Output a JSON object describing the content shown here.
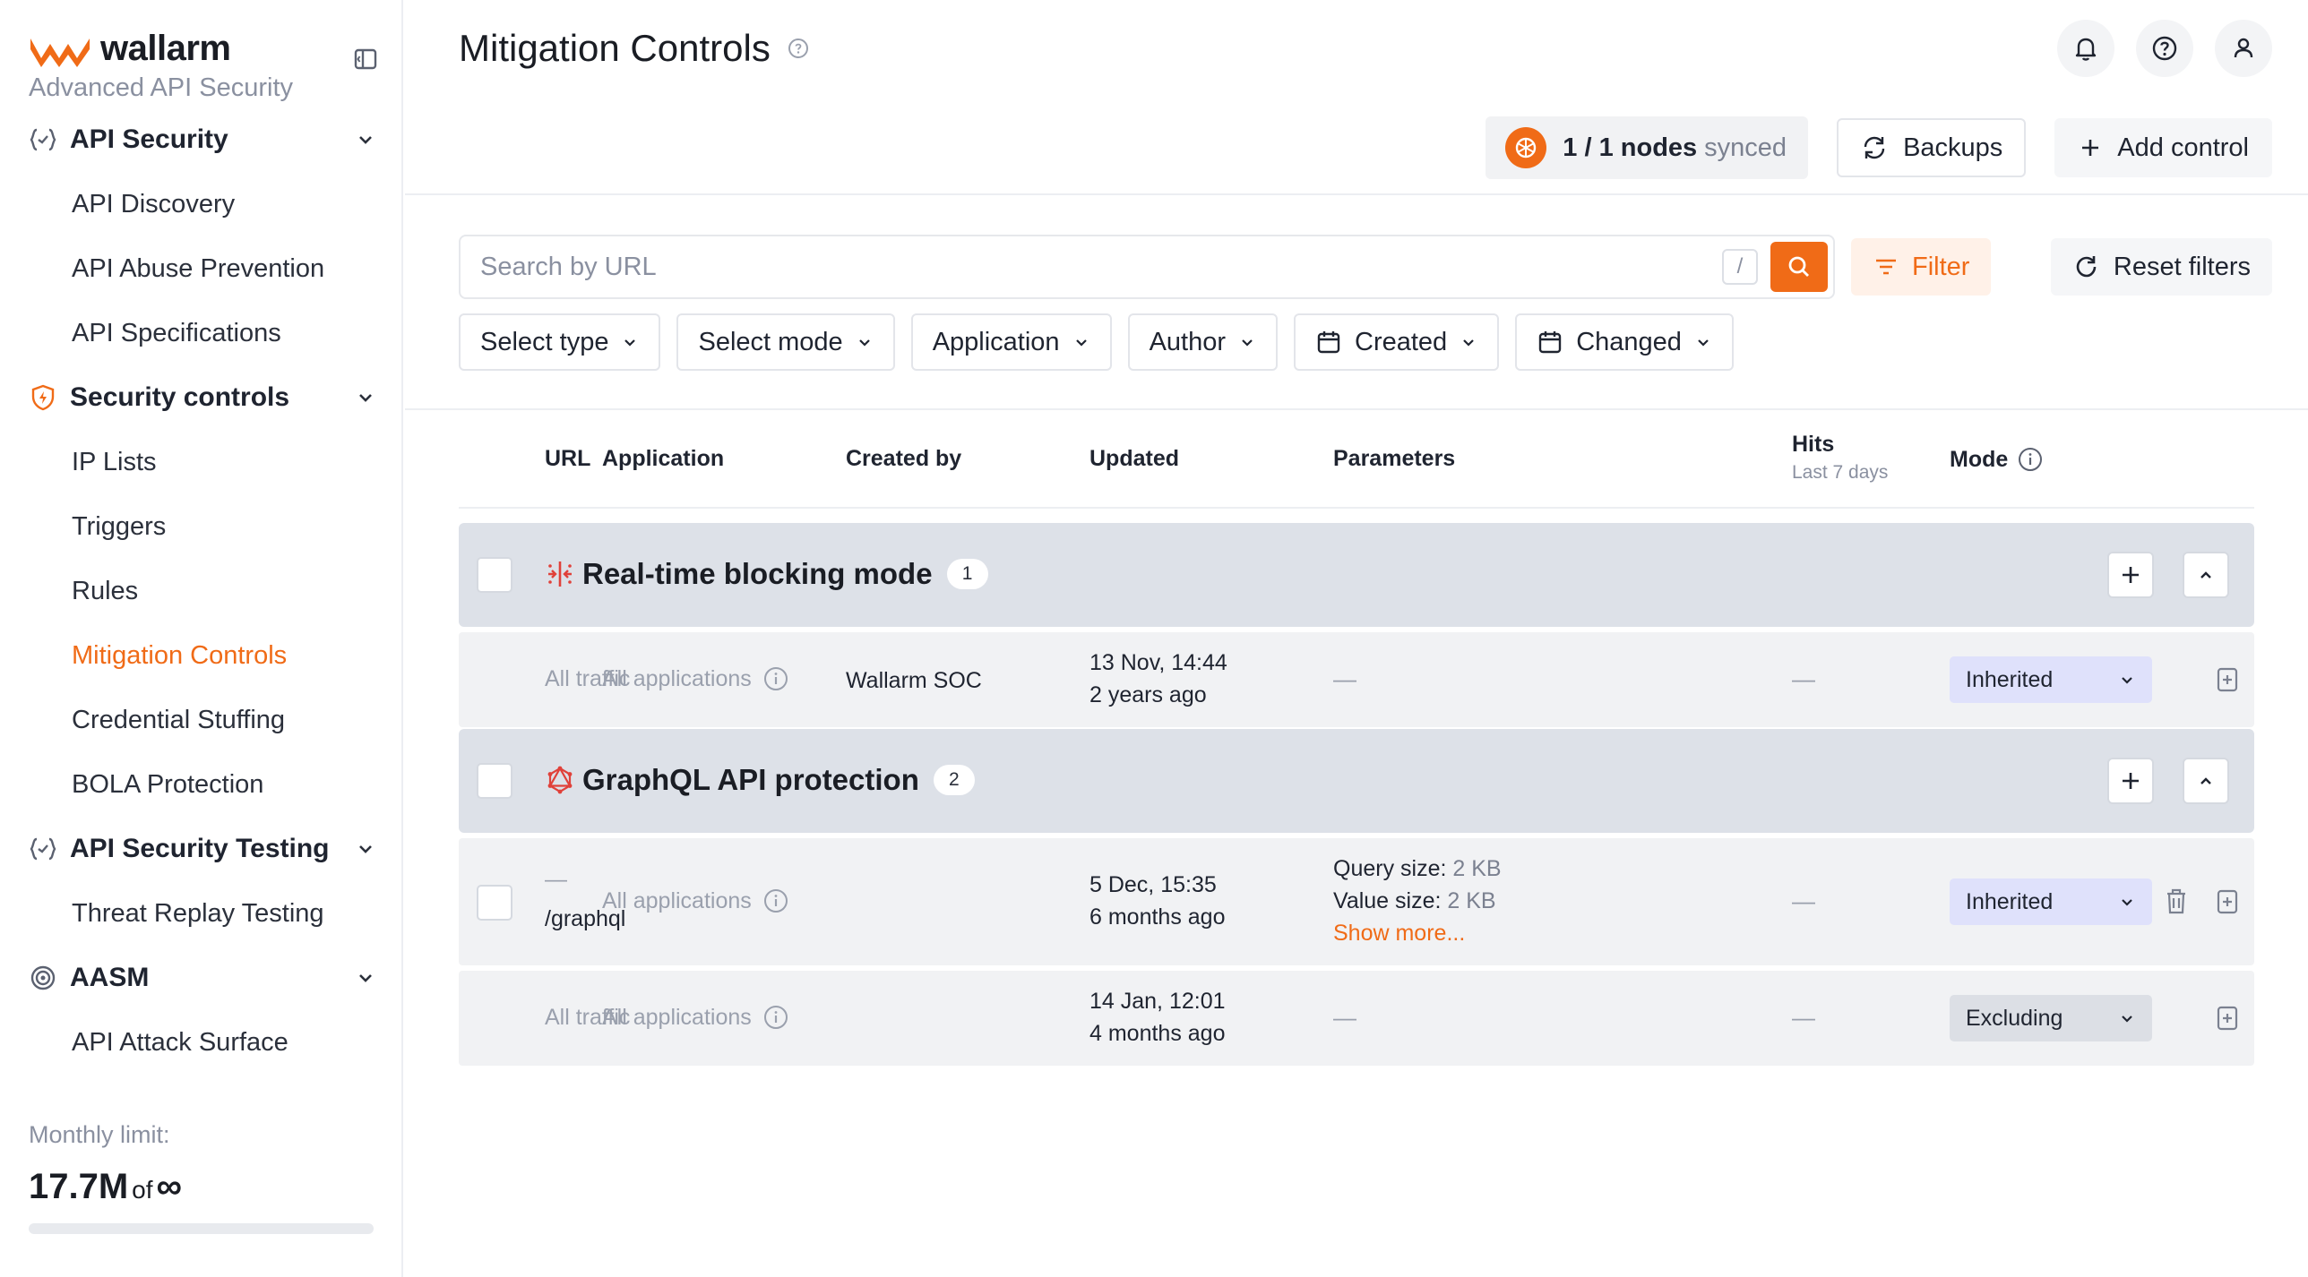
{
  "brand": {
    "name": "wallarm",
    "subtitle": "Advanced API Security",
    "accent": "#f06b17"
  },
  "sidebar": {
    "sections": [
      {
        "label": "API Security",
        "icon": "api-braces-icon",
        "items": [
          "API Discovery",
          "API Abuse Prevention",
          "API Specifications"
        ]
      },
      {
        "label": "Security controls",
        "icon": "shield-icon",
        "items": [
          "IP Lists",
          "Triggers",
          "Rules",
          "Mitigation Controls",
          "Credential Stuffing",
          "BOLA Protection"
        ]
      },
      {
        "label": "API Security Testing",
        "icon": "api-braces-icon",
        "items": [
          "Threat Replay Testing"
        ]
      },
      {
        "label": "AASM",
        "icon": "radar-icon",
        "items": [
          "API Attack Surface"
        ]
      }
    ],
    "active_item": "Mitigation Controls",
    "footer": {
      "limit_label": "Monthly limit:",
      "limit_value": "17.7M",
      "limit_of": "of",
      "limit_total": "∞"
    }
  },
  "header": {
    "title": "Mitigation Controls",
    "sync": {
      "count": "1 / 1 nodes",
      "status": "synced"
    },
    "backups_label": "Backups",
    "add_label": "Add control"
  },
  "search": {
    "placeholder": "Search by URL",
    "shortcut": "/"
  },
  "filter_label": "Filter",
  "reset_label": "Reset filters",
  "dropdowns": [
    "Select type",
    "Select mode",
    "Application",
    "Author",
    "Created",
    "Changed"
  ],
  "table": {
    "headers": {
      "url": "URL",
      "application": "Application",
      "created_by": "Created by",
      "updated": "Updated",
      "parameters": "Parameters",
      "hits": "Hits",
      "hits_sub": "Last 7 days",
      "mode": "Mode"
    },
    "groups": [
      {
        "title": "Real-time blocking mode",
        "count": "1",
        "rows": [
          {
            "url": "All traffic",
            "application": "All applications",
            "created_by": "Wallarm SOC",
            "updated_date": "13 Nov, 14:44",
            "updated_ago": "2 years ago",
            "parameters": "—",
            "hits": "—",
            "mode": "Inherited"
          }
        ]
      },
      {
        "title": "GraphQL API protection",
        "count": "2",
        "rows": [
          {
            "url_dash": "—",
            "url": "/graphql",
            "application": "All applications",
            "created_by": "",
            "updated_date": "5 Dec, 15:35",
            "updated_ago": "6 months ago",
            "param1_label": "Query size:",
            "param1_value": "2 KB",
            "param2_label": "Value size:",
            "param2_value": "2 KB",
            "show_more": "Show more...",
            "hits": "—",
            "mode": "Inherited"
          },
          {
            "url": "All traffic",
            "application": "All applications",
            "created_by": "",
            "updated_date": "14 Jan, 12:01",
            "updated_ago": "4 months ago",
            "parameters": "—",
            "hits": "—",
            "mode": "Excluding"
          }
        ]
      }
    ]
  }
}
